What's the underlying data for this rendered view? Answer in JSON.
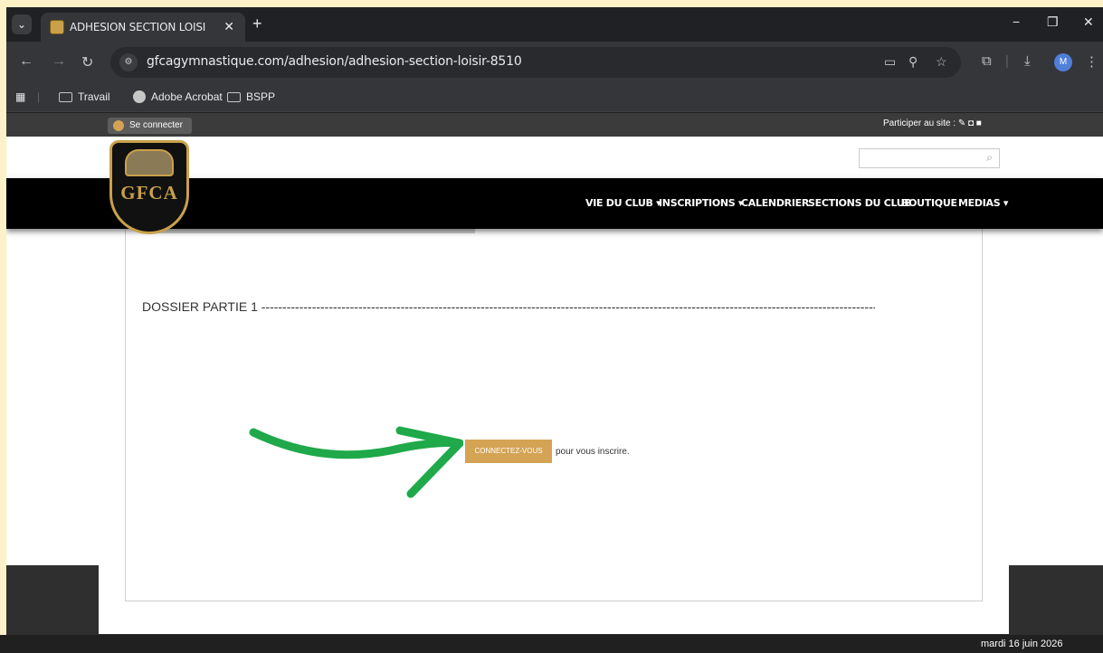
{
  "browser": {
    "tab": {
      "title": "ADHESION SECTION LOISIR - G",
      "close": "✕"
    },
    "new_tab": "+",
    "window_controls": {
      "minimize": "−",
      "restore": "❐",
      "close": "✕"
    },
    "url": "gfcagymnastique.com/adhesion/adhesion-section-loisir-8510",
    "profile_initial": "M",
    "bookmarks": [
      {
        "label": "Travail",
        "icon": "folder-icon"
      },
      {
        "label": "Adobe Acrobat",
        "icon": "globe-icon"
      },
      {
        "label": "BSPP",
        "icon": "folder-icon"
      }
    ]
  },
  "site": {
    "admin_bar": {
      "connect_label": "Se connecter",
      "participer_label": "Participer au site : ✎ ◘ ■"
    },
    "logo": {
      "text": "GFCA"
    },
    "nav": [
      {
        "label": "VIE DU CLUB ▾"
      },
      {
        "label": "INSCRIPTIONS ▾"
      },
      {
        "label": "CALENDRIER"
      },
      {
        "label": "SECTIONS DU CLUB"
      },
      {
        "label": "BOUTIQUE"
      },
      {
        "label": "MEDIAS ▾"
      }
    ],
    "search_icon": "⌕"
  },
  "content": {
    "dossier_title": "DOSSIER PARTIE 1 -----------------------------------------------------------------------------------------------------------------------------------------------------------------------------------------------",
    "connect_button": "CONNECTEZ-VOUS",
    "after_button_text": "pour vous inscrire."
  },
  "annotation": {
    "arrow_color": "#1fa94a"
  },
  "taskbar": {
    "date": "mardi 16 juin 2026"
  }
}
